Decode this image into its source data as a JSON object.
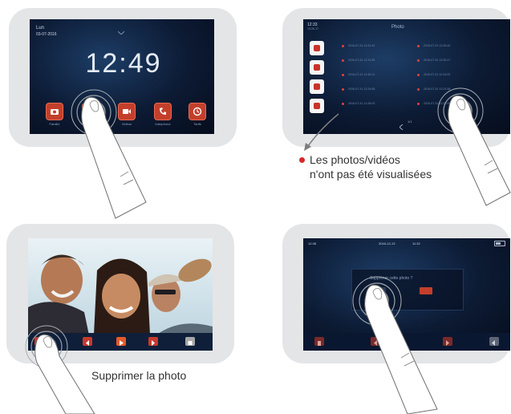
{
  "panel1": {
    "day": "Lun",
    "date": "03-07-2016",
    "time": "12:49",
    "apps": [
      {
        "label": "Famille",
        "icon": "camera-icon"
      },
      {
        "label": "Photos",
        "icon": "photo-icon"
      },
      {
        "label": "Vidéos",
        "icon": "video-icon"
      },
      {
        "label": "Interphone",
        "icon": "phone-icon"
      },
      {
        "label": "Tarifs",
        "icon": "clock-icon"
      }
    ]
  },
  "panel2": {
    "time": "12:33",
    "date": "13-06-17",
    "title": "Photo",
    "side_buttons": [
      "home-icon",
      "camera-icon",
      "video-icon",
      "trash-icon"
    ],
    "list_left": [
      "2016-07-31 12:32:42",
      "2016-07-31 12:31:55",
      "2016-07-31 12:30:11",
      "2016-07-31 12:29:48",
      "2016-07-31 12:28:03"
    ],
    "list_right": [
      "2016-07-31 12:26:40",
      "2016-07-31 12:25:17",
      "2016-07-31 12:24:02",
      "2016-07-31 12:23:38",
      "2016-07-31 12:22:09"
    ],
    "pager": "1/1"
  },
  "panel3": {
    "controls": [
      "trash-icon",
      "previous-icon",
      "play-icon",
      "next-icon",
      "stop-icon"
    ]
  },
  "panel4": {
    "time": "12:38",
    "date": "2016-12-13",
    "clock": "11:32",
    "dialog_text": "Supprimer cette photo ?",
    "controls": [
      "trash-icon",
      "previous-icon",
      "next-icon",
      "back-icon"
    ]
  },
  "captions": {
    "note_line1": "Les photos/vidéos",
    "note_line2": "n'ont pas été visualisées",
    "delete_photo": "Supprimer la photo"
  },
  "colors": {
    "frame": "#e4e5e7",
    "screen": "#0c1a33",
    "accent": "#c33f2b",
    "dot": "#d6292b",
    "arrow": "#7d7d7d"
  }
}
